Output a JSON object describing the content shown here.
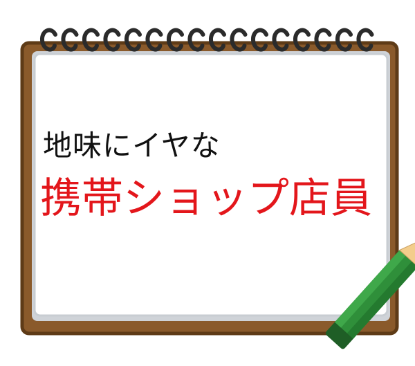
{
  "notebook": {
    "line1": "地味にイヤな",
    "line2": "携帯ショップ店員"
  },
  "colors": {
    "cover": "#8a5a2b",
    "page": "#ffffff",
    "page_shadow": "#cfd3d8",
    "ring": "#2b2b2b",
    "title_black": "#111111",
    "title_red": "#e3161b",
    "pencil_body": "#2f8f3a",
    "pencil_wood": "#f3cd8b",
    "pencil_lead": "#1a1a1a"
  },
  "icons": [
    "spiral-binding-icon",
    "pencil-icon"
  ]
}
